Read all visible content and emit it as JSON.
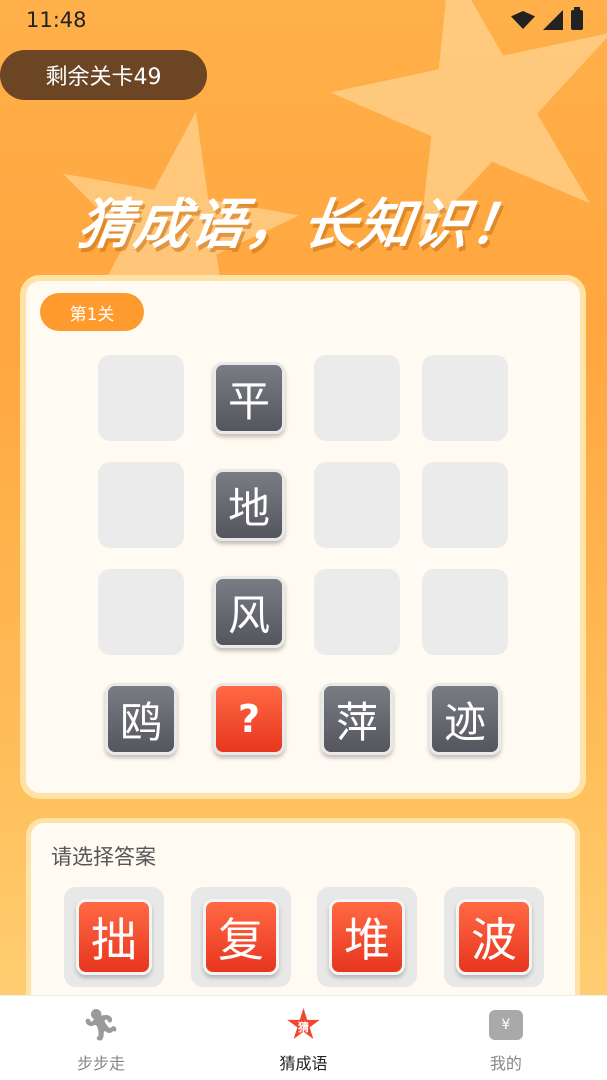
{
  "status_bar": {
    "time": "11:48"
  },
  "levels_remaining": "剩余关卡49",
  "slogan": "猜成语，长知识！",
  "puzzle": {
    "level_label": "第1关",
    "rows": [
      [
        "",
        "平",
        "",
        ""
      ],
      [
        "",
        "地",
        "",
        ""
      ],
      [
        "",
        "风",
        "",
        ""
      ],
      [
        "鸥",
        "?",
        "萍",
        "迹"
      ]
    ]
  },
  "answers": {
    "title": "请选择答案",
    "options": [
      "拙",
      "复",
      "堆",
      "波"
    ]
  },
  "tabs": [
    {
      "label": "步步走",
      "icon": "walking-person-icon",
      "active": false
    },
    {
      "label": "猜成语",
      "icon": "star-badge-icon",
      "icon_text": "猜",
      "active": true
    },
    {
      "label": "我的",
      "icon": "wallet-icon",
      "icon_text": "¥",
      "active": false
    }
  ],
  "colors": {
    "accent": "#ff9a2e",
    "tile_red": "#e8351f",
    "tile_dark": "#55565d",
    "pill_brown": "#6b4524"
  }
}
